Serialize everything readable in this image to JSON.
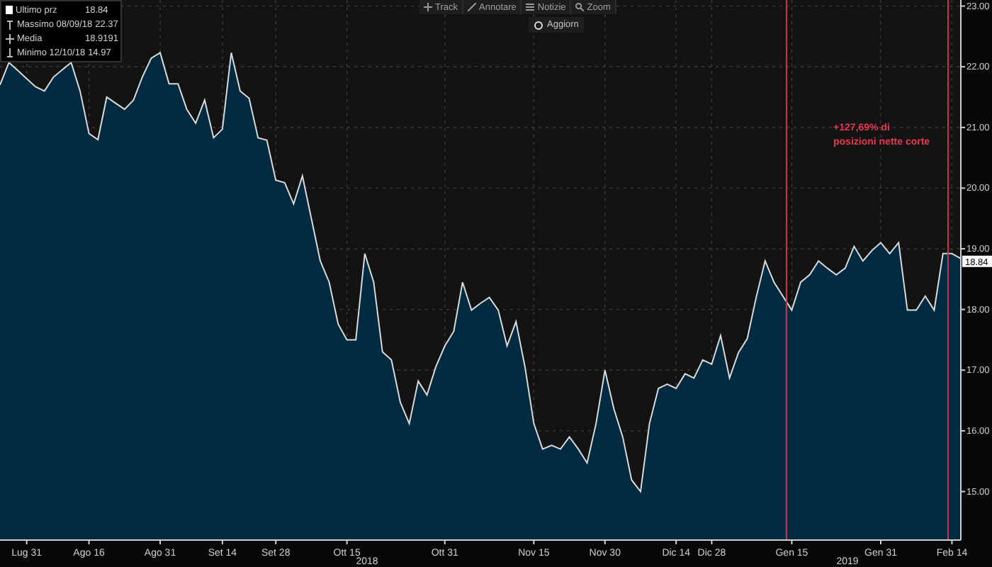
{
  "legend": [
    {
      "kind": "square",
      "value": "18.84"
    },
    {
      "kind": "max",
      "label": "Massimo 08/09/18",
      "value": "22.37"
    },
    {
      "kind": "avg",
      "label": "Media",
      "value": "18.9191"
    },
    {
      "kind": "min",
      "label": "Minimo 12/10/18",
      "value": "14.97"
    }
  ],
  "toolbar": [
    {
      "kind": "track",
      "label": "Track"
    },
    {
      "kind": "annotate",
      "label": "Annotare"
    },
    {
      "kind": "news",
      "label": "Notizie"
    },
    {
      "kind": "zoom",
      "label": "Zoom"
    }
  ],
  "refresh_button": "Aggiorn",
  "chart": {
    "last_price_tag": "18.84",
    "year_labels": [
      "2018",
      "2019"
    ],
    "chart_data": {
      "type": "area",
      "grid": true,
      "categories": [
        null,
        null,
        null,
        "Lug 31",
        null,
        null,
        null,
        null,
        null,
        null,
        "Ago 16",
        null,
        null,
        null,
        null,
        null,
        null,
        null,
        "Ago 31",
        null,
        null,
        null,
        null,
        null,
        null,
        "Set 14",
        null,
        null,
        null,
        null,
        null,
        "Set 28",
        null,
        null,
        null,
        null,
        null,
        null,
        null,
        "Ott 15",
        null,
        null,
        null,
        null,
        null,
        null,
        null,
        null,
        null,
        null,
        "Ott 31",
        null,
        null,
        null,
        null,
        null,
        null,
        null,
        null,
        null,
        "Nov 15",
        null,
        null,
        null,
        null,
        null,
        null,
        null,
        "Nov 30",
        null,
        null,
        null,
        null,
        null,
        null,
        null,
        "Dic 14",
        null,
        null,
        null,
        "Dic 28",
        null,
        null,
        null,
        null,
        null,
        null,
        null,
        null,
        "Gen 15",
        null,
        null,
        null,
        null,
        null,
        null,
        null,
        null,
        null,
        "Gen 31",
        null,
        null,
        null,
        null,
        null,
        null,
        null,
        "Feb 14",
        null
      ],
      "series": [
        {
          "name": "Ultimo prz",
          "color": "#d9d9d9",
          "values": [
            21.7,
            22.07,
            null,
            null,
            21.67,
            21.6,
            21.83,
            null,
            22.07,
            21.6,
            20.9,
            20.8,
            21.5,
            21.4,
            21.3,
            21.45,
            21.83,
            22.14,
            22.23,
            21.72,
            21.72,
            21.3,
            21.07,
            21.45,
            20.83,
            20.97,
            22.23,
            21.6,
            21.48,
            20.83,
            20.79,
            20.13,
            20.09,
            19.74,
            20.2,
            19.5,
            18.8,
            18.45,
            17.76,
            17.5,
            17.5,
            18.92,
            18.45,
            17.3,
            17.17,
            16.47,
            16.12,
            16.82,
            16.59,
            17.06,
            17.4,
            17.64,
            18.45,
            17.99,
            18.1,
            18.2,
            17.99,
            17.4,
            17.8,
            17.06,
            16.12,
            15.7,
            15.76,
            15.7,
            15.9,
            15.7,
            15.47,
            16.12,
            17.0,
            16.36,
            15.9,
            15.19,
            15.0,
            16.12,
            16.7,
            16.77,
            16.7,
            16.94,
            16.87,
            17.17,
            17.1,
            17.57,
            16.87,
            17.29,
            17.52,
            18.2,
            18.8,
            18.45,
            18.22,
            17.99,
            18.45,
            18.57,
            18.8,
            18.68,
            18.57,
            18.68,
            19.04,
            18.8,
            18.97,
            19.1,
            18.92,
            19.1,
            17.99,
            17.99,
            18.22,
            17.99,
            18.92,
            18.92,
            18.84
          ]
        }
      ],
      "ylim": [
        14.2,
        23.1
      ],
      "yticks": [
        {
          "value": 15,
          "label": "15.00"
        },
        {
          "value": 16,
          "label": "16.00"
        },
        {
          "value": 17,
          "label": "17.00"
        },
        {
          "value": 18,
          "label": "18.00"
        },
        {
          "value": 19,
          "label": "19.00"
        },
        {
          "value": 20,
          "label": "20.00"
        },
        {
          "value": 21,
          "label": "21.00"
        },
        {
          "value": 22,
          "label": "22.00"
        },
        {
          "value": 23,
          "label": "23.00"
        }
      ],
      "annotations": [
        "+127,69% di\nposizioni nette corte"
      ]
    }
  }
}
